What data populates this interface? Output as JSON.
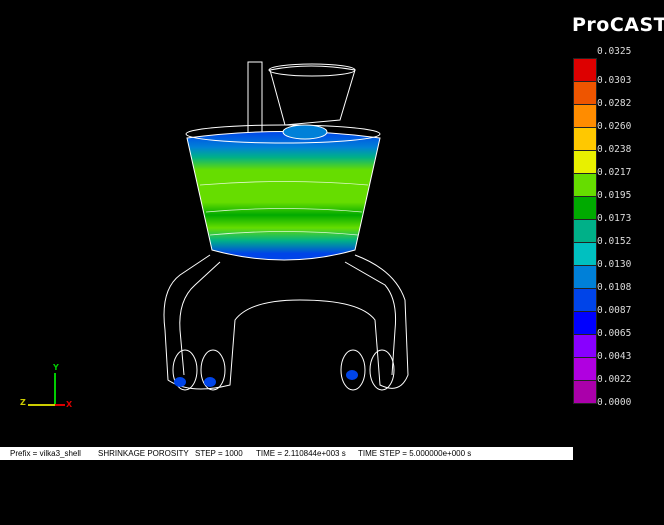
{
  "logo": "ProCAST",
  "legend": {
    "top_value": "0.0325",
    "items": [
      {
        "color": "#dd0000",
        "label": "0.0303"
      },
      {
        "color": "#ee5500",
        "label": "0.0282"
      },
      {
        "color": "#ff8c00",
        "label": "0.0260"
      },
      {
        "color": "#ffc800",
        "label": "0.0238"
      },
      {
        "color": "#e8f000",
        "label": "0.0217"
      },
      {
        "color": "#66dd00",
        "label": "0.0195"
      },
      {
        "color": "#00aa00",
        "label": "0.0173"
      },
      {
        "color": "#00b088",
        "label": "0.0152"
      },
      {
        "color": "#00c0c0",
        "label": "0.0130"
      },
      {
        "color": "#0080d8",
        "label": "0.0108"
      },
      {
        "color": "#0044e8",
        "label": "0.0087"
      },
      {
        "color": "#0000ff",
        "label": "0.0065"
      },
      {
        "color": "#8800ff",
        "label": "0.0043"
      },
      {
        "color": "#b000e0",
        "label": "0.0022"
      },
      {
        "color": "#aa00aa",
        "label": "0.0000"
      }
    ]
  },
  "axes": {
    "x": "X",
    "y": "Y",
    "z": "Z"
  },
  "status": {
    "prefix": "Prefix = vilka3_shell",
    "field": "SHRINKAGE POROSITY",
    "step": "STEP = 1000",
    "time": "TIME = 2.110844e+003 s",
    "time_step": "TIME STEP = 5.000000e+000 s"
  }
}
